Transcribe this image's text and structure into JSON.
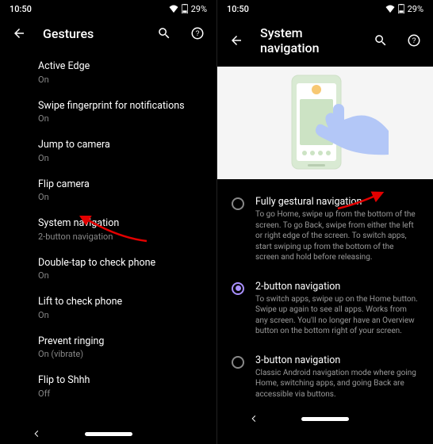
{
  "status": {
    "time": "10:50",
    "battery_text": "29%"
  },
  "left": {
    "title": "Gestures",
    "items": [
      {
        "title": "Active Edge",
        "sub": "On"
      },
      {
        "title": "Swipe fingerprint for notifications",
        "sub": "On"
      },
      {
        "title": "Jump to camera",
        "sub": "On"
      },
      {
        "title": "Flip camera",
        "sub": "On"
      },
      {
        "title": "System navigation",
        "sub": "2-button navigation"
      },
      {
        "title": "Double-tap to check phone",
        "sub": "On"
      },
      {
        "title": "Lift to check phone",
        "sub": "On"
      },
      {
        "title": "Prevent ringing",
        "sub": "On (vibrate)"
      },
      {
        "title": "Flip to Shhh",
        "sub": "Off"
      }
    ]
  },
  "right": {
    "title": "System navigation",
    "options": [
      {
        "title": "Fully gestural navigation",
        "desc": "To go Home, swipe up from the bottom of the screen. To go Back, swipe from either the left or right edge of the screen. To switch apps, start swiping up from the bottom of the screen and hold before releasing.",
        "selected": false
      },
      {
        "title": "2-button navigation",
        "desc": "To switch apps, swipe up on the Home button. Swipe up again to see all apps. Works from any screen. You'll no longer have an Overview button on the bottom right of your screen.",
        "selected": true
      },
      {
        "title": "3-button navigation",
        "desc": "Classic Android navigation mode where going Home, switching apps, and going Back are accessible via buttons.",
        "selected": false
      }
    ]
  }
}
